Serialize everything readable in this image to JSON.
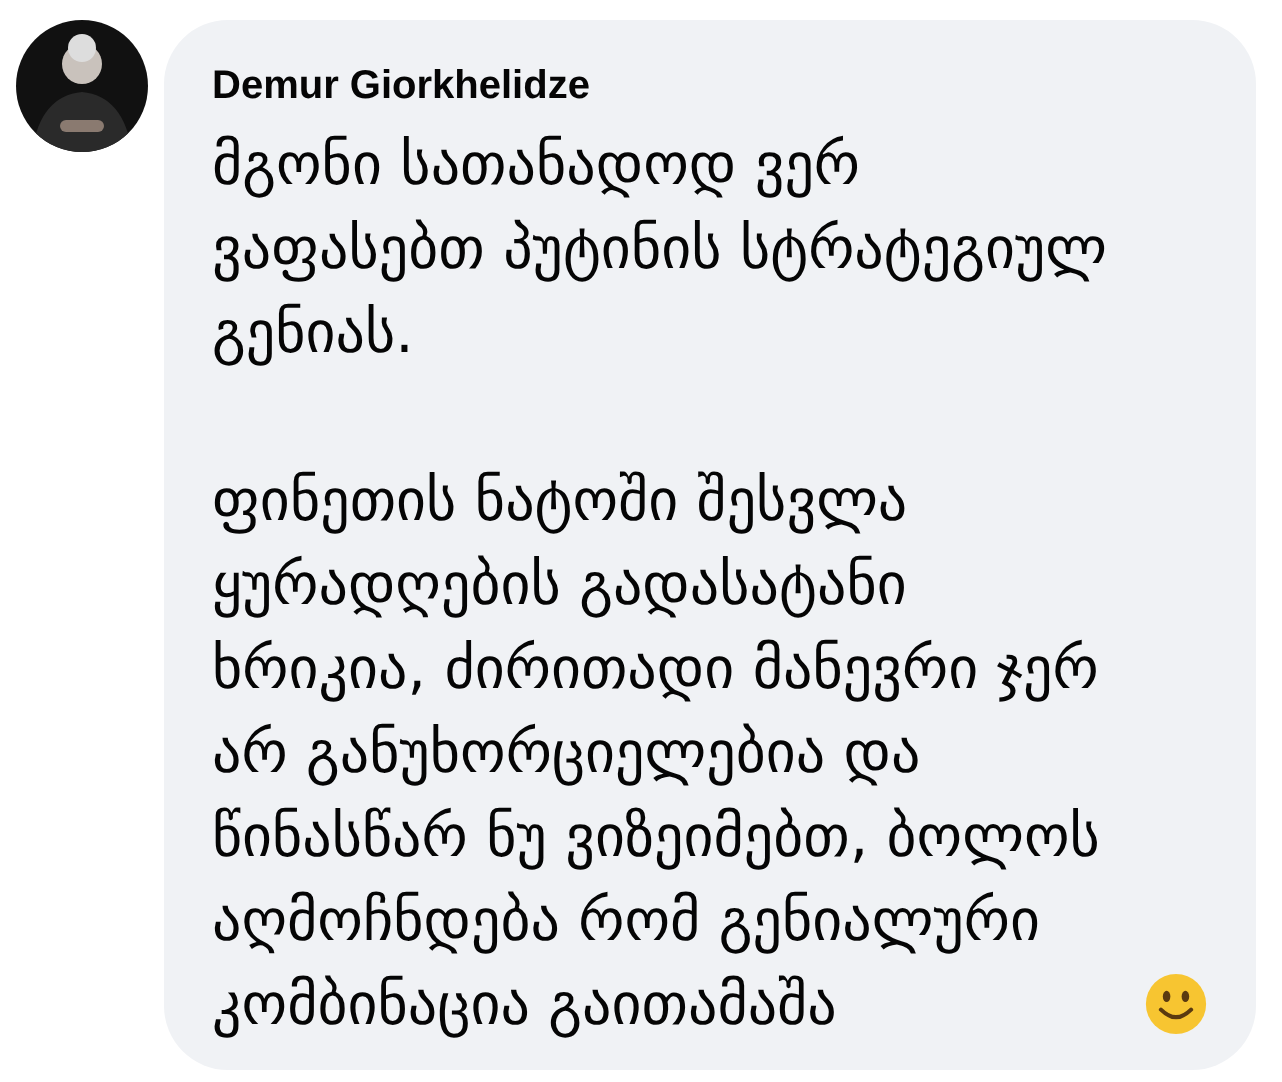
{
  "comment": {
    "author": "Demur Giorkhelidze",
    "paragraphs": [
      "მგონი სათანადოდ ვერ ვაფასებთ პუტინის სტრატეგიულ გენიას.",
      "ფინეთის ნატოში შესვლა ყურადღების გადასატანი ხრიკია, ძირითადი მანევრი ჯერ არ განუხორციელებია და წინასწარ ნუ ვიზეიმებთ, ბოლოს აღმოჩნდება რომ გენიალური კომბინაცია გაითამაშა"
    ]
  }
}
